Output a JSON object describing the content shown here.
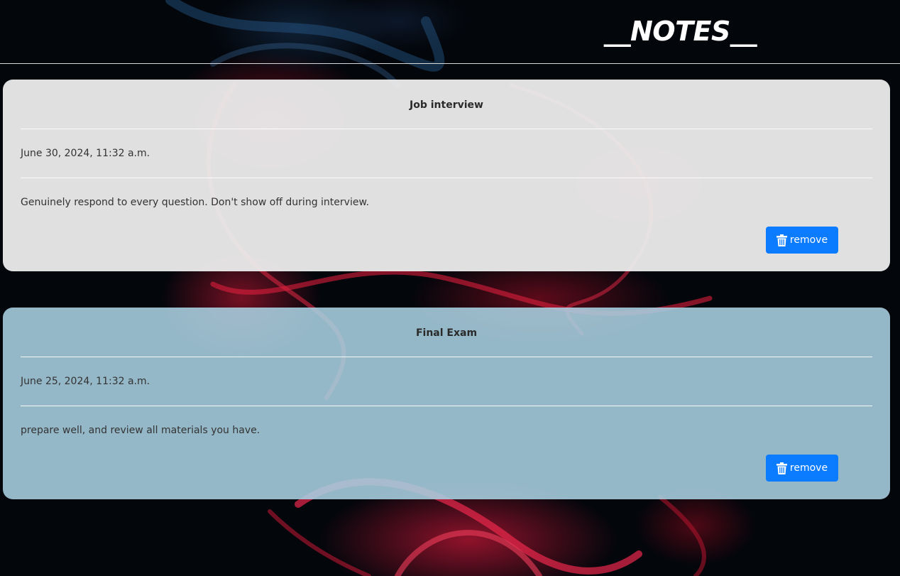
{
  "header": {
    "title": "__NOTES__"
  },
  "notes": [
    {
      "title": "Job interview",
      "date": "June 30, 2024, 11:32 a.m.",
      "body": "Genuinely respond to every question. Don't show off during interview.",
      "remove_label": "remove",
      "remove_icon": "trash-icon",
      "card_color": "#e8e8e8"
    },
    {
      "title": "Final Exam",
      "date": "June 25, 2024, 11:32 a.m.",
      "body": "prepare well, and review all materials you have.",
      "remove_label": "remove",
      "remove_icon": "trash-icon",
      "card_color": "#a9cfdc"
    }
  ],
  "colors": {
    "button": "#0b7bff",
    "background": "#03060b",
    "smoke": "#d0163c"
  }
}
